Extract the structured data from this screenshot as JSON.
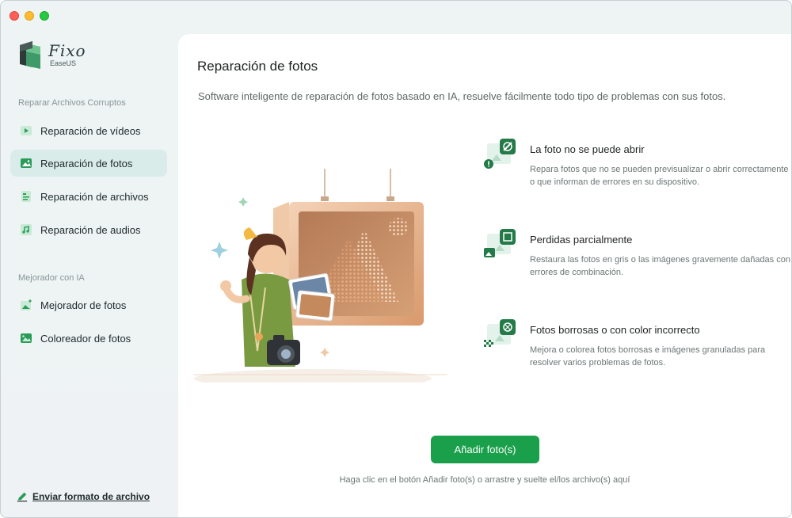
{
  "app": {
    "name": "Fixo",
    "vendor": "EaseUS"
  },
  "sidebar": {
    "section_repair": "Reparar Archivos Corruptos",
    "repair_items": [
      {
        "label": "Reparación de vídeos",
        "icon": "video-icon"
      },
      {
        "label": "Reparación de fotos",
        "icon": "photo-icon",
        "active": true
      },
      {
        "label": "Reparación de archivos",
        "icon": "file-icon"
      },
      {
        "label": "Reparación de audios",
        "icon": "audio-icon"
      }
    ],
    "section_ai": "Mejorador con IA",
    "ai_items": [
      {
        "label": "Mejorador de fotos",
        "icon": "photo-enhance-icon"
      },
      {
        "label": "Coloreador de fotos",
        "icon": "photo-colorize-icon"
      }
    ],
    "feedback_link": "Enviar formato de archivo"
  },
  "main": {
    "title": "Reparación de fotos",
    "subtitle": "Software inteligente de reparación de fotos basado en IA, resuelve fácilmente todo tipo de problemas con sus fotos.",
    "features": [
      {
        "title": "La foto no se puede abrir",
        "description": "Repara fotos que no se pueden previsualizar o abrir correctamente o que informan de errores en su dispositivo."
      },
      {
        "title": "Perdidas parcialmente",
        "description": "Restaura las fotos en gris o las imágenes gravemente dañadas con errores de combinación."
      },
      {
        "title": "Fotos borrosas o con color incorrecto",
        "description": "Mejora o colorea fotos borrosas e imágenes granuladas para resolver varios problemas de fotos."
      }
    ],
    "add_button": "Añadir foto(s)",
    "hint": "Haga clic en el botón Añadir foto(s) o arrastre y suelte el/los archivo(s) aquí"
  },
  "colors": {
    "accent": "#1a9f4b",
    "active_nav": "#d9ecea",
    "sidebar_bg": "#eef3f4"
  }
}
